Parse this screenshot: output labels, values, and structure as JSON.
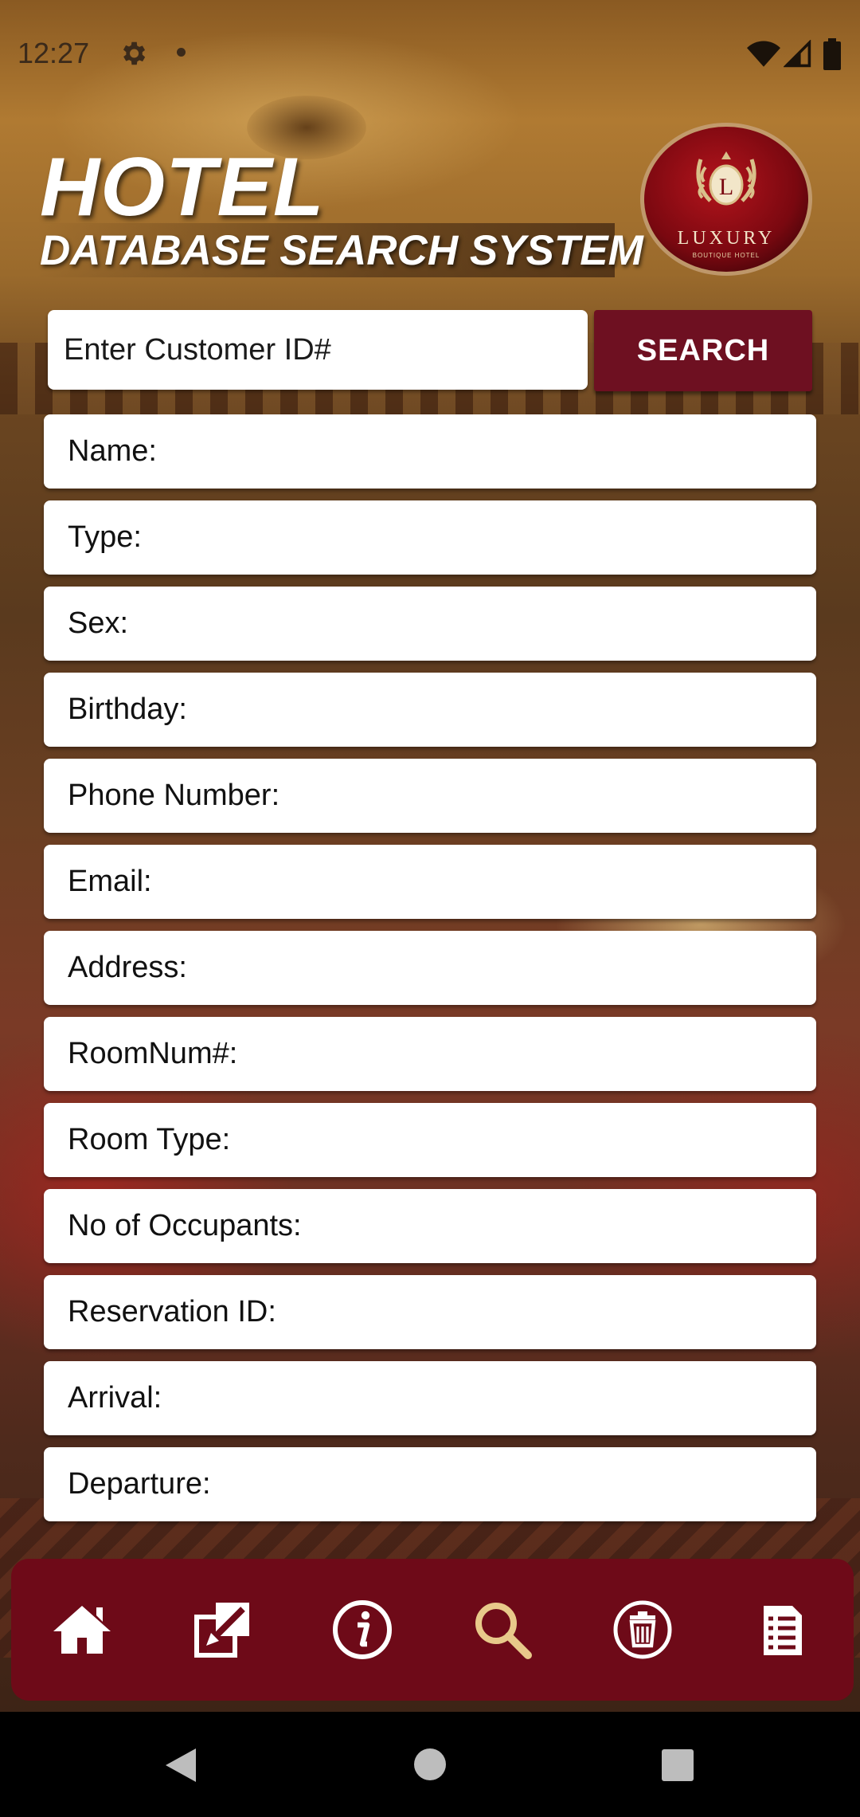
{
  "status_bar": {
    "time": "12:27"
  },
  "header": {
    "title": "HOTEL",
    "subtitle": "DATABASE SEARCH SYSTEM",
    "logo": {
      "letter": "L",
      "name": "LUXURY",
      "tagline": "BOUTIQUE HOTEL"
    }
  },
  "search": {
    "placeholder": "Enter Customer ID#",
    "value": "",
    "button_label": "SEARCH"
  },
  "fields": [
    "Name:",
    "Type:",
    "Sex:",
    "Birthday:",
    "Phone Number:",
    "Email:",
    "Address:",
    "RoomNum#:",
    "Room Type:",
    "No of Occupants:",
    "Reservation ID:",
    "Arrival:",
    "Departure:"
  ],
  "bottom_nav": {
    "items": [
      "home-icon",
      "edit-icon",
      "info-icon",
      "search-icon",
      "delete-icon",
      "list-icon"
    ],
    "active": "search-icon",
    "active_color": "#e8c98a",
    "background": "#6e0a18"
  },
  "theme": {
    "accent": "#6e1021",
    "field_background": "#ffffff"
  }
}
